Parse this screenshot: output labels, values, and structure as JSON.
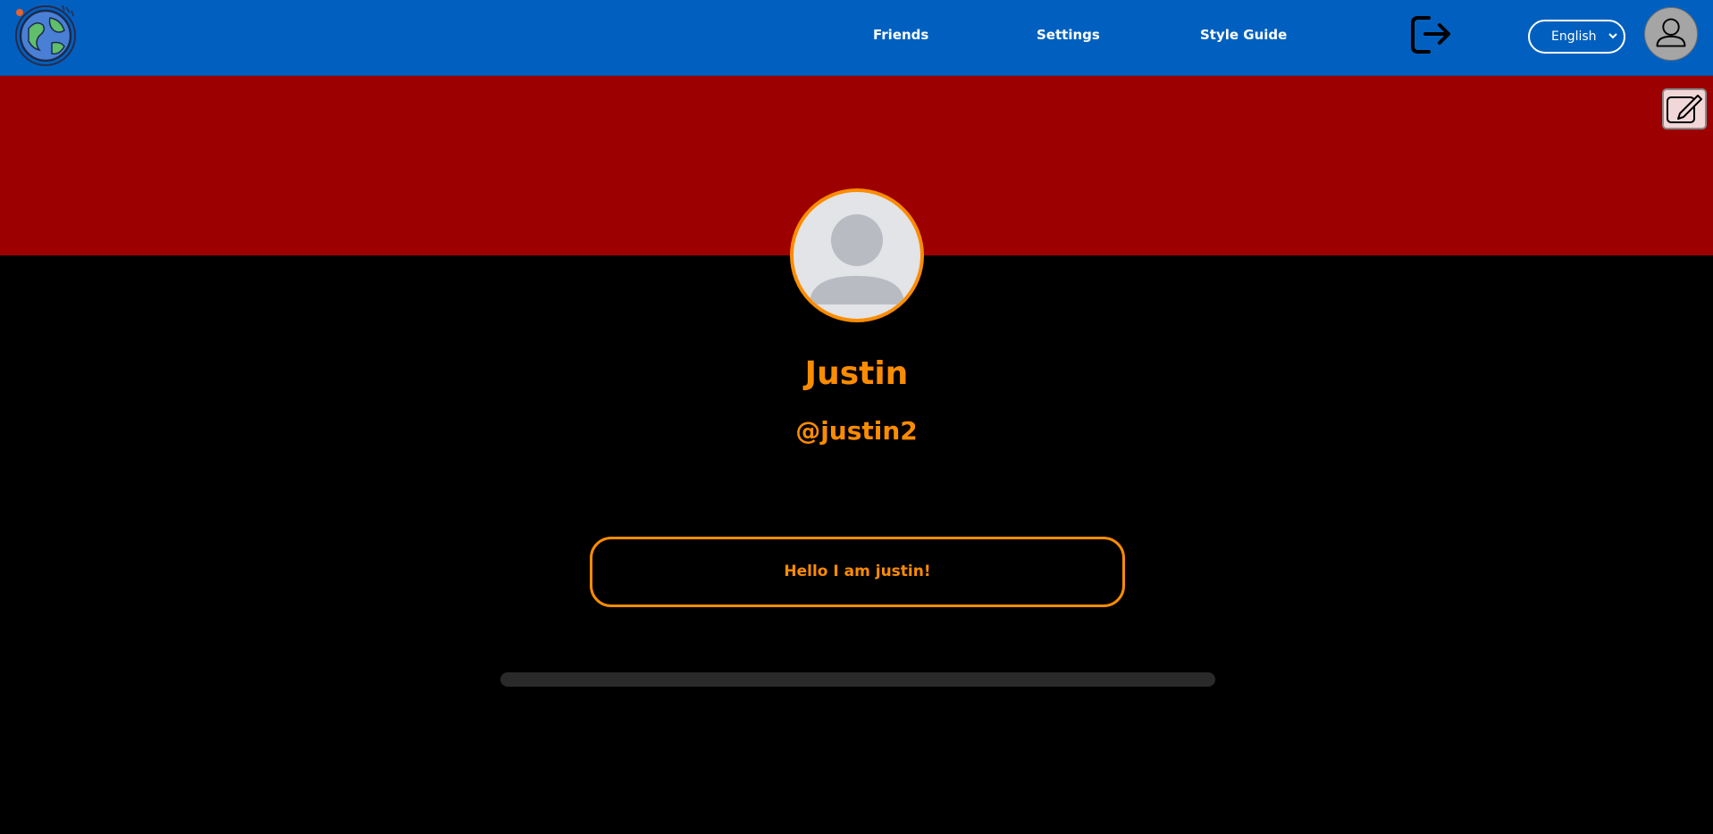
{
  "navbar": {
    "background": "#0160bf",
    "logo_icon": "globe-icon",
    "links": [
      {
        "label": "Friends"
      },
      {
        "label": "Settings"
      },
      {
        "label": "Style Guide"
      }
    ],
    "logout_icon": "logout-icon",
    "language": {
      "selected": "English"
    },
    "avatar_icon": "user-icon"
  },
  "banner": {
    "color": "#9d0000",
    "edit_icon": "pencil-icon"
  },
  "profile": {
    "display_name": "Justin",
    "username": "@justin2",
    "bio": "Hello I am justin!",
    "accent": "#fb8c00"
  }
}
